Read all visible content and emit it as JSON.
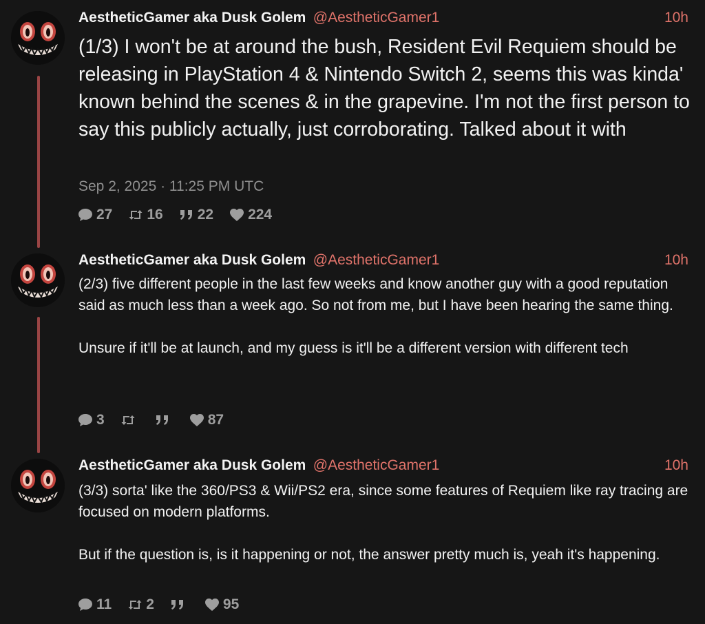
{
  "tweets": [
    {
      "name": "AestheticGamer aka Dusk Golem",
      "handle": "@AestheticGamer1",
      "time": "10h",
      "text": "(1/3) I won't be at around the bush, Resident Evil Requiem should be releasing in PlayStation 4 & Nintendo Switch 2, seems this was kinda' known behind the scenes & in the grapevine. I'm not the first person to say this publicly actually, just corroborating. Talked about it with",
      "date": "Sep 2, 2025 · 11:25 PM UTC",
      "replies": "27",
      "retweets": "16",
      "quotes": "22",
      "likes": "224"
    },
    {
      "name": "AestheticGamer aka Dusk Golem",
      "handle": "@AestheticGamer1",
      "time": "10h",
      "text": "(2/3) five different people in the last few weeks and know another guy with a good reputation said as much less than a week ago. So not from me, but I have been hearing the same thing.\n\nUnsure if it'll be at launch, and my guess is it'll be a different version with different tech",
      "replies": "3",
      "retweets": "",
      "quotes": "",
      "likes": "87"
    },
    {
      "name": "AestheticGamer aka Dusk Golem",
      "handle": "@AestheticGamer1",
      "time": "10h",
      "text": "(3/3) sorta' like the 360/PS3 & Wii/PS2 era, since some features of Requiem like ray tracing are focused on modern platforms.\n\nBut if the question is, is it happening or not, the answer pretty much is, yeah it's happening.",
      "replies": "11",
      "retweets": "2",
      "quotes": "",
      "likes": "95"
    }
  ],
  "icons": {
    "reply": "comment-icon",
    "retweet": "retweet-icon",
    "quote": "quote-icon",
    "like": "heart-icon"
  },
  "colors": {
    "background": "#161616",
    "accent": "#e0736a",
    "thread_line": "#9a4545",
    "muted": "#9e9e9e"
  }
}
